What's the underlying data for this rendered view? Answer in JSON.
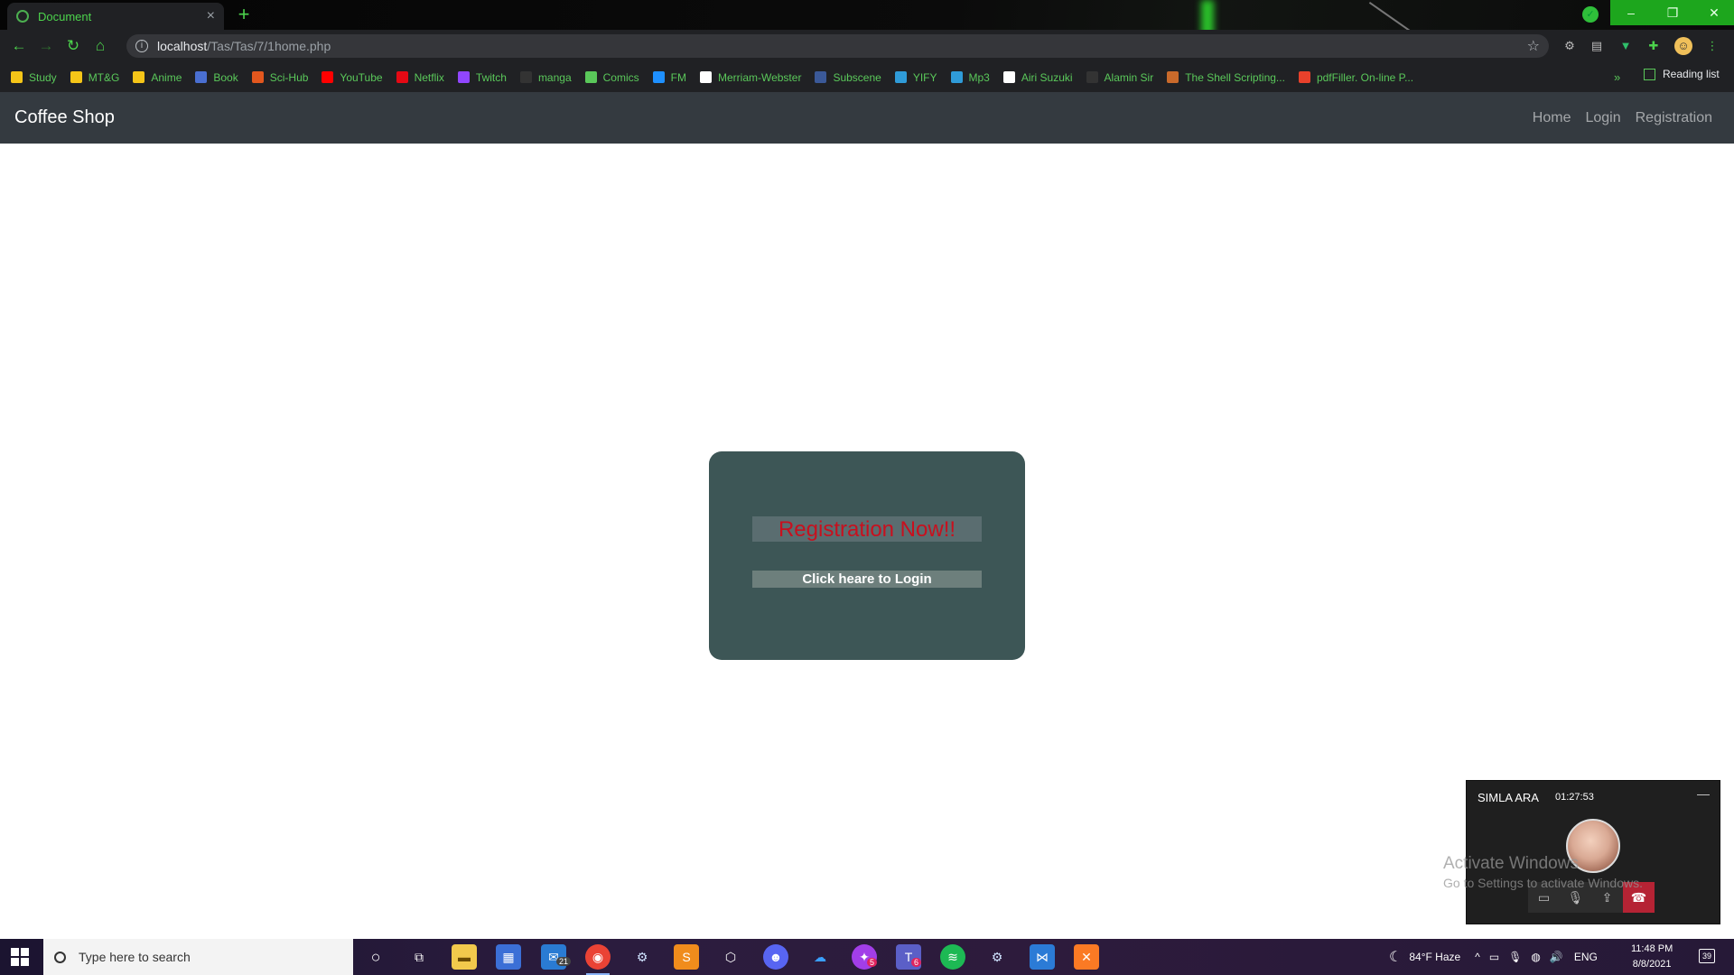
{
  "browser": {
    "tab_title": "Document",
    "tab_close": "×",
    "new_tab": "+",
    "url_host": "localhost",
    "url_path": "/Tas/Tas/7/1home.php",
    "window_controls": [
      "–",
      "❐",
      "✕"
    ],
    "bookmarks": [
      {
        "label": "Study",
        "icon": "folder-icon",
        "color": "#f5c518"
      },
      {
        "label": "MT&G",
        "icon": "folder-icon",
        "color": "#f5c518"
      },
      {
        "label": "Anime",
        "icon": "folder-icon",
        "color": "#f5c518"
      },
      {
        "label": "Book",
        "icon": "book-icon",
        "color": "#4a6fd1"
      },
      {
        "label": "Sci-Hub",
        "icon": "scihub-icon",
        "color": "#e2571e"
      },
      {
        "label": "YouTube",
        "icon": "youtube-icon",
        "color": "#ff0000"
      },
      {
        "label": "Netflix",
        "icon": "netflix-icon",
        "color": "#e50914"
      },
      {
        "label": "Twitch",
        "icon": "twitch-icon",
        "color": "#9146ff"
      },
      {
        "label": "manga",
        "icon": "manga-icon",
        "color": "#333333"
      },
      {
        "label": "Comics",
        "icon": "globe-icon",
        "color": "#5ac85a"
      },
      {
        "label": "FM",
        "icon": "play-icon",
        "color": "#1e90ff"
      },
      {
        "label": "Merriam-Webster",
        "icon": "dictionary-icon",
        "color": "#ffffff"
      },
      {
        "label": "Subscene",
        "icon": "subscene-icon",
        "color": "#3b5998"
      },
      {
        "label": "YIFY",
        "icon": "yify-icon",
        "color": "#2f9bd8"
      },
      {
        "label": "Mp3",
        "icon": "download-icon",
        "color": "#2f9bd8"
      },
      {
        "label": "Airi Suzuki",
        "icon": "google-icon",
        "color": "#ffffff"
      },
      {
        "label": "Alamin Sir",
        "icon": "github-icon",
        "color": "#333333"
      },
      {
        "label": "The Shell Scripting...",
        "icon": "book-icon",
        "color": "#c96a2b"
      },
      {
        "label": "pdfFiller. On-line P...",
        "icon": "pdf-icon",
        "color": "#e8412b"
      }
    ],
    "more_bookmarks": "»",
    "reading_list": "Reading list"
  },
  "site": {
    "brand": "Coffee Shop",
    "nav": [
      "Home",
      "Login",
      "Registration"
    ],
    "register_button": "Registration Now!!",
    "login_button": "Click heare to Login"
  },
  "call": {
    "name": "SIMLA ARA",
    "timer": "01:27:53"
  },
  "watermark": {
    "line1": "Activate Windows",
    "line2": "Go to Settings to activate Windows."
  },
  "taskbar": {
    "search_placeholder": "Type here to search",
    "mail_badge": "21",
    "messenger_badge": "5",
    "teams_badge": "6",
    "weather": "84°F  Haze",
    "language": "ENG",
    "time": "11:48 PM",
    "date": "8/8/2021",
    "notifications": "39"
  },
  "colors": {
    "navbar": "#343a40",
    "card": "#3d5656",
    "register_text": "#c8101e",
    "browser_accent": "#4cd34c"
  }
}
